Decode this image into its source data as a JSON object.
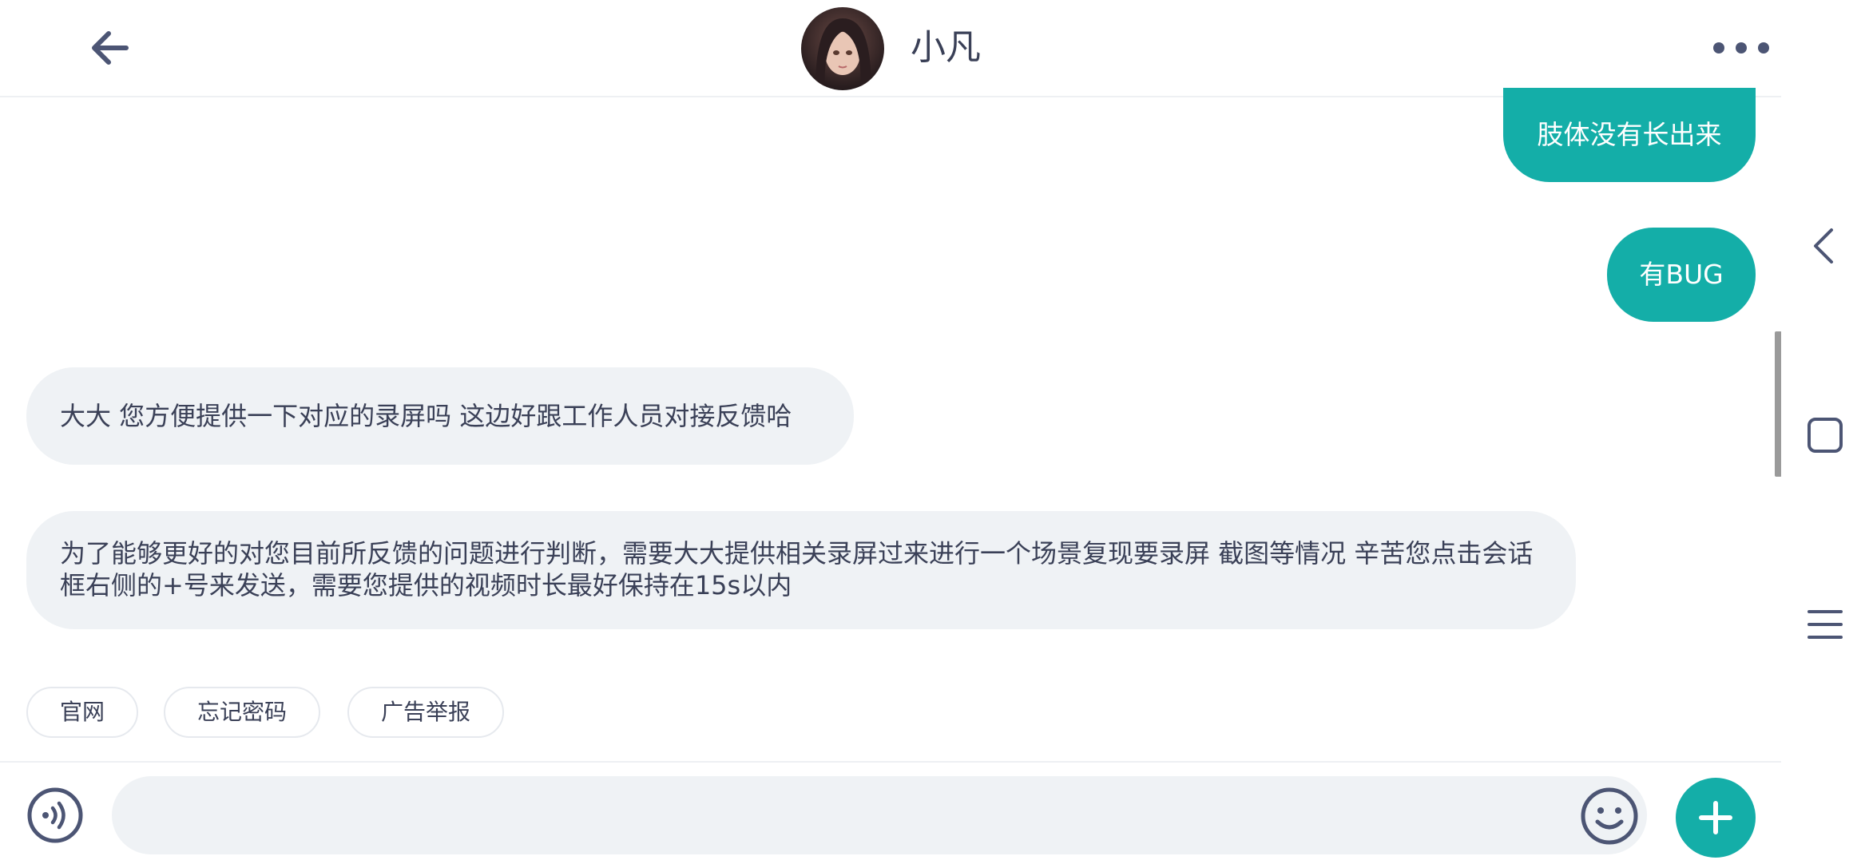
{
  "header": {
    "contact_name": "小凡",
    "back_icon": "arrow-left-icon",
    "more_icon": "more-dots-icon",
    "avatar_icon": "avatar"
  },
  "messages": [
    {
      "direction": "outgoing",
      "text": "肢体没有长出来"
    },
    {
      "direction": "outgoing",
      "text": "有BUG"
    },
    {
      "direction": "incoming",
      "text": "大大 您方便提供一下对应的录屏吗 这边好跟工作人员对接反馈哈"
    },
    {
      "direction": "incoming",
      "text": "为了能够更好的对您目前所反馈的问题进行判断，需要大大提供相关录屏过来进行一个场景复现要录屏 截图等情况 辛苦您点击会话框右侧的+号来发送，需要您提供的视频时长最好保持在15s以内"
    }
  ],
  "quick_replies": [
    "官网",
    "忘记密码",
    "广告举报"
  ],
  "input_bar": {
    "placeholder": "",
    "voice_icon": "voice-icon",
    "emoji_icon": "emoji-icon",
    "plus_icon": "plus-icon"
  },
  "system_nav": [
    "back-icon",
    "home-icon",
    "recents-icon"
  ],
  "colors": {
    "accent": "#14aea8",
    "incoming_bubble": "#eff2f5",
    "text": "#3a4057"
  }
}
